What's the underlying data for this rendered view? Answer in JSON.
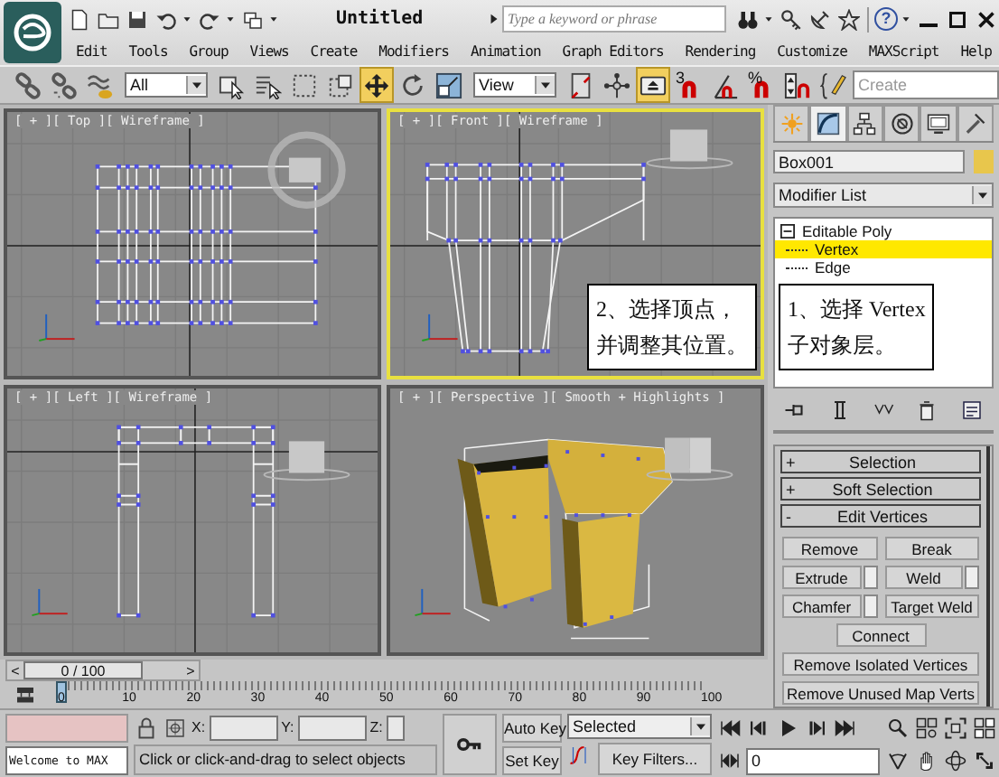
{
  "title_bar": {
    "title": "Untitled",
    "search": {
      "placeholder": "Type a keyword or phrase"
    },
    "help": "?"
  },
  "menu": [
    "Edit",
    "Tools",
    "Group",
    "Views",
    "Create",
    "Modifiers",
    "Animation",
    "Graph Editors",
    "Rendering",
    "Customize",
    "MAXScript",
    "Help"
  ],
  "toolbar": [
    {
      "kind": "link",
      "selected": false
    },
    {
      "kind": "unlink",
      "selected": false
    },
    {
      "kind": "bind",
      "selected": false
    },
    {
      "kind": "dropdown",
      "value": "All"
    },
    {
      "kind": "select",
      "selected": false
    },
    {
      "kind": "select-by-name",
      "selected": false
    },
    {
      "kind": "rect-region",
      "selected": false
    },
    {
      "kind": "window-crossing",
      "selected": false
    },
    {
      "kind": "move",
      "selected": true
    },
    {
      "kind": "rotate",
      "selected": false
    },
    {
      "kind": "scale",
      "selected": false
    },
    {
      "kind": "dropdown",
      "value": "View"
    },
    {
      "kind": "pivot",
      "selected": false
    },
    {
      "kind": "manipulate",
      "selected": false
    },
    {
      "kind": "keyboard",
      "selected": true
    },
    {
      "kind": "snap",
      "label": "3",
      "selected": false
    },
    {
      "kind": "angle-snap",
      "selected": false
    },
    {
      "kind": "snap",
      "label": "%",
      "selected": false
    },
    {
      "kind": "spinner-snap",
      "selected": false
    },
    {
      "kind": "named-sets",
      "selected": false
    },
    {
      "kind": "field",
      "placeholder": "Create"
    }
  ],
  "viewports": [
    {
      "label": "[ + ][ Top ][ Wireframe ]",
      "kind": "top",
      "active": false
    },
    {
      "label": "[ + ][ Front ][ Wireframe ]",
      "kind": "front",
      "active": true,
      "callout": [
        "2、选择顶点，",
        "并调整其位置。"
      ]
    },
    {
      "label": "[ + ][ Left ][ Wireframe ]",
      "kind": "left",
      "active": false
    },
    {
      "label": "[ + ][ Perspective ][ Smooth + Highlights ]",
      "kind": "perspective",
      "active": false
    }
  ],
  "command_panel": {
    "tabs": [
      {
        "kind": "create",
        "selected": false
      },
      {
        "kind": "modify",
        "selected": true
      },
      {
        "kind": "hierarchy",
        "selected": false
      },
      {
        "kind": "motion",
        "selected": false
      },
      {
        "kind": "display",
        "selected": false
      },
      {
        "kind": "utilities",
        "selected": false
      }
    ],
    "object": {
      "name": "Box001",
      "color": "#e8c64c"
    },
    "modifier_list": "Modifier List",
    "stack": [
      {
        "label": "Editable Poly",
        "expanded": true,
        "selected": false,
        "children": [
          {
            "label": "Vertex",
            "selected": true
          },
          {
            "label": "Edge",
            "selected": false
          }
        ]
      }
    ],
    "callout": [
      "1、选择 Vertex",
      "子对象层。"
    ],
    "rollouts": [
      {
        "sign": "+",
        "title": "Selection"
      },
      {
        "sign": "+",
        "title": "Soft Selection"
      },
      {
        "sign": "-",
        "title": "Edit Vertices",
        "rows": [
          [
            {
              "label": "Remove",
              "settings": false
            },
            {
              "label": "Break",
              "settings": false
            }
          ],
          [
            {
              "label": "Extrude",
              "settings": true
            },
            {
              "label": "Weld",
              "settings": true
            }
          ],
          [
            {
              "label": "Chamfer",
              "settings": true
            },
            {
              "label": "Target Weld",
              "settings": false
            }
          ],
          [
            {
              "label": "Connect",
              "settings": false
            }
          ],
          [
            {
              "label": "Remove Isolated Vertices",
              "settings": false
            }
          ],
          [
            {
              "label": "Remove Unused Map Verts",
              "settings": false
            }
          ]
        ]
      }
    ]
  },
  "timeline": {
    "prev": "<",
    "frame": "0 / 100",
    "next": ">",
    "ticks": [
      "0",
      "10",
      "20",
      "30",
      "40",
      "50",
      "60",
      "70",
      "80",
      "90",
      "100"
    ]
  },
  "status_bar": {
    "welcome": "Welcome to MAX",
    "coords": [
      "X:",
      "Y:",
      "Z:"
    ],
    "prompt": "Click or click-and-drag to select objects",
    "auto_key": "Auto Key",
    "set_key": "Set Key",
    "key_mode": "Selected",
    "key_filters": "Key Filters...",
    "frame": "0"
  }
}
